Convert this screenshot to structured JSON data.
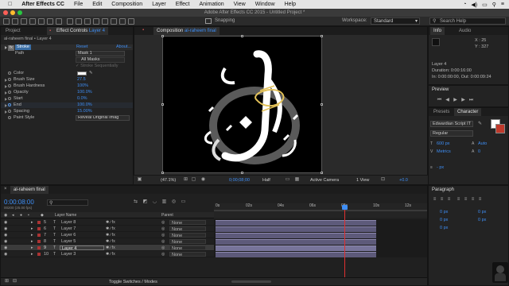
{
  "menubar": {
    "apple_icon": "apple-icon",
    "app": "After Effects CC",
    "items": [
      "File",
      "Edit",
      "Composition",
      "Layer",
      "Effect",
      "Animation",
      "View",
      "Window",
      "Help"
    ]
  },
  "window_title": "Adobe After Effects CC 2015 - Untitled Project *",
  "toolbar": {
    "snapping": "Snapping",
    "workspace_label": "Workspace:",
    "workspace_value": "Standard",
    "search_placeholder": "Search Help"
  },
  "effect_panel": {
    "tab_project": "Project",
    "tab_effect_controls": "Effect Controls",
    "tab_effect_layer": "Layer 4",
    "breadcrumb": "al-raheem final • Layer 4",
    "effect_name": "Stroke",
    "reset": "Reset",
    "about": "About...",
    "path_label": "Path",
    "path_value": "Mask 1",
    "all_masks": "All Masks",
    "stroke_seq": "Stroke Sequentially",
    "props": [
      {
        "label": "Color",
        "value": ""
      },
      {
        "label": "Brush Size",
        "value": "27.5"
      },
      {
        "label": "Brush Hardness",
        "value": "100%"
      },
      {
        "label": "Opacity",
        "value": "100.0%"
      },
      {
        "label": "Start",
        "value": "0.0%"
      },
      {
        "label": "End",
        "value": "100.0%"
      },
      {
        "label": "Spacing",
        "value": "15.00%"
      }
    ],
    "paint_style_label": "Paint Style",
    "paint_style_value": "Reveal Original Imag"
  },
  "comp_panel": {
    "tab_label": "Composition",
    "tab_name": "al-raheem final",
    "zoom": "(47.1%)",
    "timecode": "0;00;08;00",
    "resolution": "Half",
    "camera": "Active Camera",
    "view": "1 View",
    "exposure": "+0.0"
  },
  "info_panel": {
    "tab_info": "Info",
    "tab_audio": "Audio",
    "x": "X : 25",
    "y": "Y : 327",
    "layer": "Layer 4",
    "duration": "Duration: 0:00:16:00",
    "in": "In: 0:00:00:00, Out: 0:00:09:24"
  },
  "preview_panel": {
    "title": "Preview"
  },
  "presets_tab": "Presets",
  "character_panel": {
    "title": "Character",
    "font": "Edwardian Script IT",
    "style": "Regular",
    "size": "600 px",
    "leading": "Auto",
    "kerning": "Metrics",
    "tracking": "0",
    "stroke_width": "- px"
  },
  "paragraph_panel": {
    "title": "Paragraph",
    "indent_left": "0 px",
    "indent_right": "0 px",
    "indent_first": "0 px",
    "space_before": "0 px",
    "space_after": "0 px"
  },
  "timeline": {
    "tab": "al-raheem final",
    "timecode": "0:00:08:00",
    "fps": "00200 (25.00 fps)",
    "col_layer_name": "Layer Name",
    "col_parent": "Parent",
    "ruler": [
      "0s",
      "02s",
      "04s",
      "06s",
      "08s",
      "10s",
      "12s"
    ],
    "layers": [
      {
        "num": "5",
        "name": "Layer 8",
        "parent": "None"
      },
      {
        "num": "6",
        "name": "Layer 7",
        "parent": "None"
      },
      {
        "num": "7",
        "name": "Layer 6",
        "parent": "None"
      },
      {
        "num": "8",
        "name": "Layer 5",
        "parent": "None"
      },
      {
        "num": "9",
        "name": "Layer 4",
        "parent": "None"
      },
      {
        "num": "10",
        "name": "Layer 3",
        "parent": "None"
      }
    ],
    "toggle_label": "Toggle Switches / Modes"
  }
}
